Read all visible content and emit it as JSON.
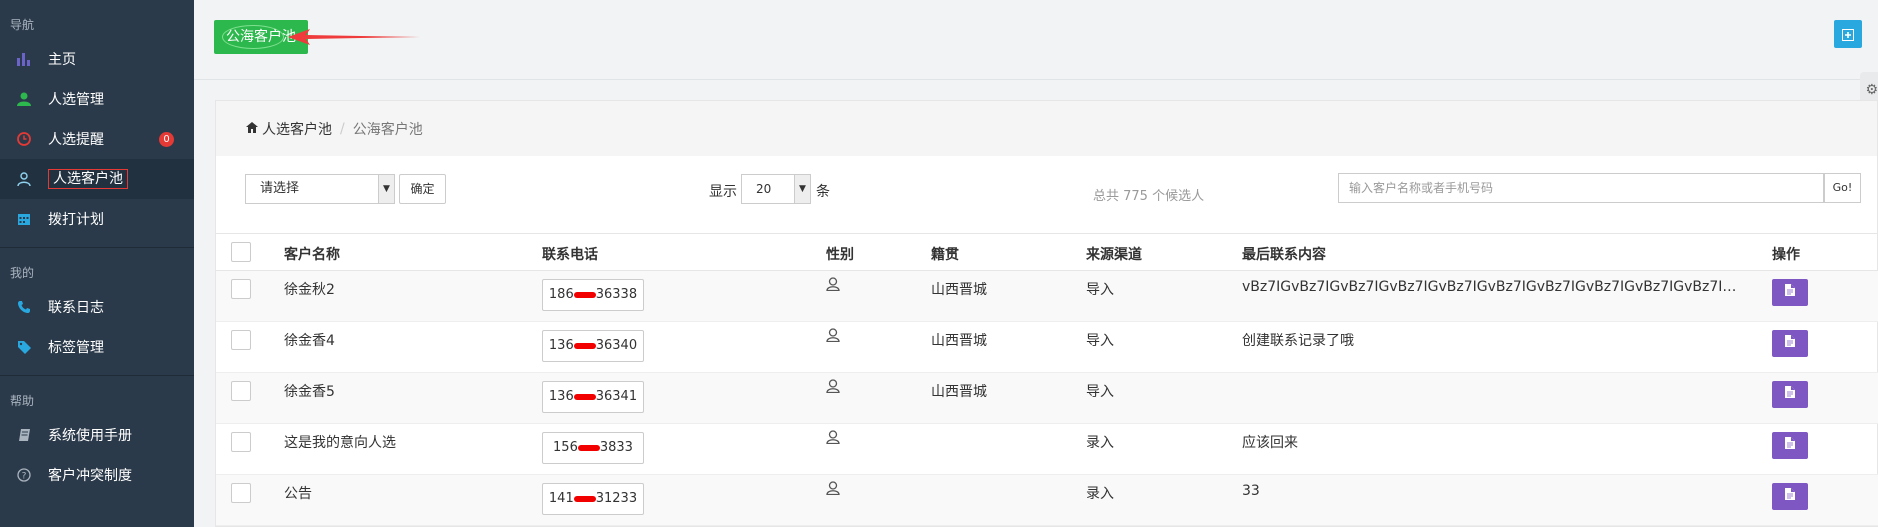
{
  "sidebar": {
    "sections": [
      {
        "title": "导航",
        "items": [
          {
            "label": "主页",
            "icon": "bar-chart-icon",
            "color": "#6c63c9"
          },
          {
            "label": "人选管理",
            "icon": "user-icon",
            "color": "#2db84d"
          },
          {
            "label": "人选提醒",
            "icon": "clock-icon",
            "color": "#e53935",
            "badge": "0"
          },
          {
            "label": "人选客户池",
            "icon": "user-tie-icon",
            "color": "#ffffff",
            "active": true
          },
          {
            "label": "拨打计划",
            "icon": "calendar-icon",
            "color": "#29a8e0"
          }
        ]
      },
      {
        "title": "我的",
        "items": [
          {
            "label": "联系日志",
            "icon": "phone-icon",
            "color": "#29a8e0"
          },
          {
            "label": "标签管理",
            "icon": "tags-icon",
            "color": "#29a8e0"
          }
        ]
      },
      {
        "title": "帮助",
        "items": [
          {
            "label": "系统使用手册",
            "icon": "book-icon",
            "color": "#aab4bf"
          },
          {
            "label": "客户冲突制度",
            "icon": "question-circle-icon",
            "color": "#aab4bf"
          }
        ]
      }
    ]
  },
  "topbar": {
    "page_button": "公海客户池",
    "plus_icon": "plus-square-icon"
  },
  "breadcrumb": {
    "home": "人选客户池",
    "current": "公海客户池"
  },
  "filters": {
    "select_value": "请选择",
    "confirm_label": "确定",
    "show_label": "显示",
    "page_size": "20",
    "unit_label": "条",
    "total_text": "总共 775 个候选人",
    "search_placeholder": "输入客户名称或者手机号码",
    "go_label": "Go!"
  },
  "table": {
    "columns": [
      "客户名称",
      "联系电话",
      "性别",
      "籍贯",
      "来源渠道",
      "最后联系内容",
      "操作"
    ],
    "rows": [
      {
        "name": "徐金秋2",
        "phone_prefix": "186",
        "phone_suffix": "36338",
        "gender": "未知",
        "origin": "山西晋城",
        "source": "导入",
        "last": "vBz7IGvBz7IGvBz7IGvBz7IGvBz7IGvBz7IGvBz7IGvBz7IGvBz7IGvBz7IGvBz7IGvBz7IGv..."
      },
      {
        "name": "徐金香4",
        "phone_prefix": "136",
        "phone_suffix": "36340",
        "gender": "未知",
        "origin": "山西晋城",
        "source": "导入",
        "last": "创建联系记录了哦"
      },
      {
        "name": "徐金香5",
        "phone_prefix": "136",
        "phone_suffix": "36341",
        "gender": "未知",
        "origin": "山西晋城",
        "source": "导入",
        "last": ""
      },
      {
        "name": "这是我的意向人选",
        "phone_prefix": "156",
        "phone_suffix": "3833",
        "gender": "未知",
        "origin": "",
        "source": "录入",
        "last": "应该回来"
      },
      {
        "name": "公告",
        "phone_prefix": "141",
        "phone_suffix": "31233",
        "gender": "未知",
        "origin": "",
        "source": "录入",
        "last": "33"
      }
    ]
  }
}
